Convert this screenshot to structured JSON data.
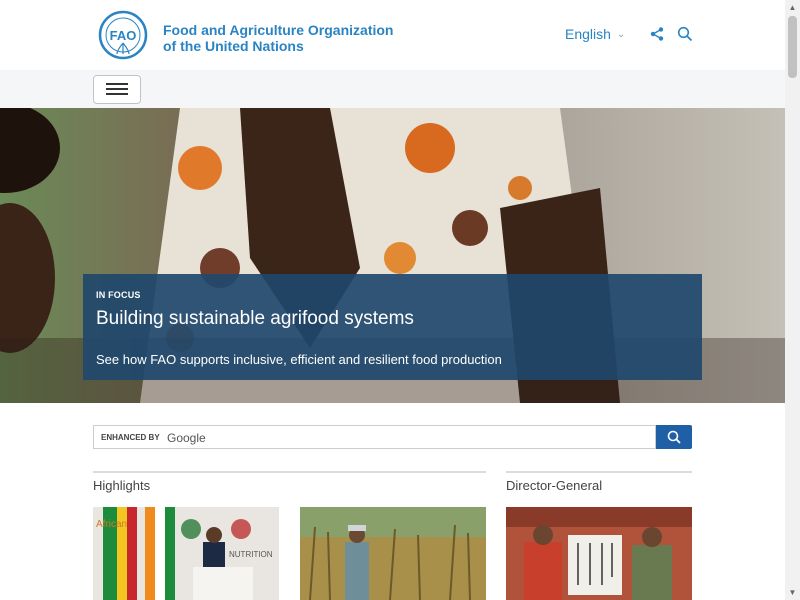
{
  "header": {
    "org_line1": "Food and Agriculture Organization",
    "org_line2": "of the United Nations",
    "logo_text": "FAO",
    "logo_motto": "FIAT PANIS",
    "language": "English",
    "icons": [
      "share-icon",
      "search-icon",
      "chevron-down-icon"
    ]
  },
  "nav": {
    "menu_icon": "hamburger-menu-icon"
  },
  "hero": {
    "label": "IN FOCUS",
    "title": "Building sustainable agrifood systems",
    "subtitle": "See how FAO supports inclusive, efficient and resilient food production"
  },
  "search": {
    "enhanced_label": "ENHANCED BY",
    "google_word": "Google",
    "button_icon": "search-icon"
  },
  "sections": {
    "highlights": "Highlights",
    "director_general": "Director-General"
  },
  "cards": {
    "card1_banner_text1": "African",
    "card1_banner_text2": "NUTRITION"
  },
  "colors": {
    "brand_blue": "#2a84c4",
    "focus_box": "#1f486d",
    "search_button": "#1f5fa6"
  }
}
